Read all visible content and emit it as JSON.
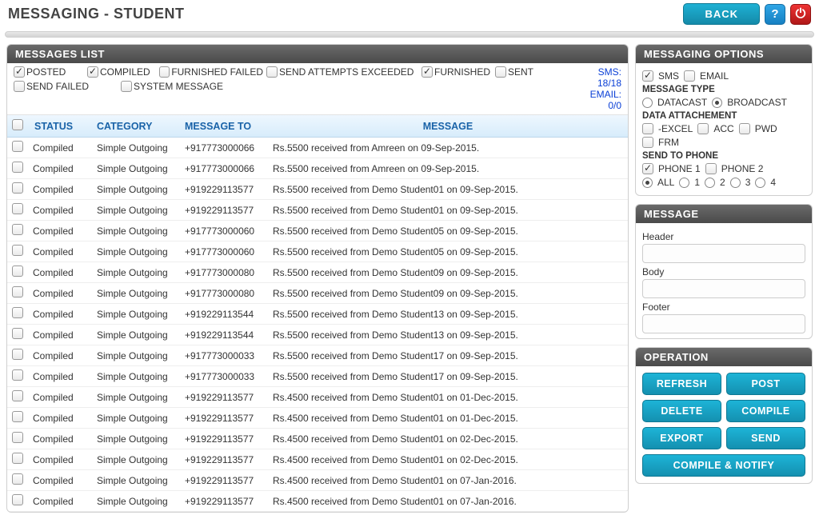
{
  "title": "MESSAGING - STUDENT",
  "back_label": "BACK",
  "counts": {
    "sms": "SMS: 18/18",
    "email": "EMAIL: 0/0"
  },
  "filters": [
    {
      "id": "posted",
      "label": "POSTED",
      "checked": true
    },
    {
      "id": "compiled",
      "label": "COMPILED",
      "checked": true
    },
    {
      "id": "ffailed",
      "label": "FURNISHED FAILED",
      "checked": false
    },
    {
      "id": "sae",
      "label": "SEND ATTEMPTS EXCEEDED",
      "checked": false
    },
    {
      "id": "furnished",
      "label": "FURNISHED",
      "checked": true
    },
    {
      "id": "sent",
      "label": "SENT",
      "checked": false
    },
    {
      "id": "sfailed",
      "label": "SEND FAILED",
      "checked": false
    },
    {
      "id": "sysmsg",
      "label": "SYSTEM MESSAGE",
      "checked": false
    }
  ],
  "columns": {
    "status": "STATUS",
    "category": "CATEGORY",
    "to": "MESSAGE TO",
    "msg": "MESSAGE"
  },
  "rows": [
    {
      "status": "Compiled",
      "category": "Simple Outgoing",
      "to": "+917773000066",
      "msg": "Rs.5500 received from Amreen on 09-Sep-2015."
    },
    {
      "status": "Compiled",
      "category": "Simple Outgoing",
      "to": "+917773000066",
      "msg": "Rs.5500 received from Amreen on 09-Sep-2015."
    },
    {
      "status": "Compiled",
      "category": "Simple Outgoing",
      "to": "+919229113577",
      "msg": "Rs.5500 received from Demo Student01 on 09-Sep-2015."
    },
    {
      "status": "Compiled",
      "category": "Simple Outgoing",
      "to": "+919229113577",
      "msg": "Rs.5500 received from Demo Student01 on 09-Sep-2015."
    },
    {
      "status": "Compiled",
      "category": "Simple Outgoing",
      "to": "+917773000060",
      "msg": "Rs.5500 received from Demo Student05 on 09-Sep-2015."
    },
    {
      "status": "Compiled",
      "category": "Simple Outgoing",
      "to": "+917773000060",
      "msg": "Rs.5500 received from Demo Student05 on 09-Sep-2015."
    },
    {
      "status": "Compiled",
      "category": "Simple Outgoing",
      "to": "+917773000080",
      "msg": "Rs.5500 received from Demo Student09 on 09-Sep-2015."
    },
    {
      "status": "Compiled",
      "category": "Simple Outgoing",
      "to": "+917773000080",
      "msg": "Rs.5500 received from Demo Student09 on 09-Sep-2015."
    },
    {
      "status": "Compiled",
      "category": "Simple Outgoing",
      "to": "+919229113544",
      "msg": "Rs.5500 received from Demo Student13 on 09-Sep-2015."
    },
    {
      "status": "Compiled",
      "category": "Simple Outgoing",
      "to": "+919229113544",
      "msg": "Rs.5500 received from Demo Student13 on 09-Sep-2015."
    },
    {
      "status": "Compiled",
      "category": "Simple Outgoing",
      "to": "+917773000033",
      "msg": "Rs.5500 received from Demo Student17 on 09-Sep-2015."
    },
    {
      "status": "Compiled",
      "category": "Simple Outgoing",
      "to": "+917773000033",
      "msg": "Rs.5500 received from Demo Student17 on 09-Sep-2015."
    },
    {
      "status": "Compiled",
      "category": "Simple Outgoing",
      "to": "+919229113577",
      "msg": "Rs.4500 received from Demo Student01 on 01-Dec-2015."
    },
    {
      "status": "Compiled",
      "category": "Simple Outgoing",
      "to": "+919229113577",
      "msg": "Rs.4500 received from Demo Student01 on 01-Dec-2015."
    },
    {
      "status": "Compiled",
      "category": "Simple Outgoing",
      "to": "+919229113577",
      "msg": "Rs.4500 received from Demo Student01 on 02-Dec-2015."
    },
    {
      "status": "Compiled",
      "category": "Simple Outgoing",
      "to": "+919229113577",
      "msg": "Rs.4500 received from Demo Student01 on 02-Dec-2015."
    },
    {
      "status": "Compiled",
      "category": "Simple Outgoing",
      "to": "+919229113577",
      "msg": "Rs.4500 received from Demo Student01 on 07-Jan-2016."
    },
    {
      "status": "Compiled",
      "category": "Simple Outgoing",
      "to": "+919229113577",
      "msg": "Rs.4500 received from Demo Student01 on 07-Jan-2016."
    }
  ],
  "panels": {
    "list": "MESSAGES LIST",
    "options": "MESSAGING OPTIONS",
    "message": "MESSAGE",
    "operation": "OPERATION"
  },
  "options": {
    "sms": {
      "label": "SMS",
      "checked": true
    },
    "email": {
      "label": "EMAIL",
      "checked": false
    },
    "msgtype_label": "MESSAGE TYPE",
    "msgtype": {
      "datacast": "DATACAST",
      "broadcast": "BROADCAST",
      "selected": "broadcast"
    },
    "attach_label": "DATA ATTACHEMENT",
    "attach": {
      "excel": {
        "label": "-EXCEL",
        "checked": false
      },
      "acc": {
        "label": "ACC",
        "checked": false
      },
      "pwd": {
        "label": "PWD",
        "checked": false
      },
      "frm": {
        "label": "FRM",
        "checked": false
      }
    },
    "sendto_label": "SEND TO PHONE",
    "phone1": {
      "label": "PHONE 1",
      "checked": true
    },
    "phone2": {
      "label": "PHONE 2",
      "checked": false
    },
    "scope": {
      "all": "ALL",
      "one": "1",
      "two": "2",
      "three": "3",
      "four": "4",
      "selected": "all"
    }
  },
  "message_fields": {
    "header": "Header",
    "body": "Body",
    "footer": "Footer"
  },
  "ops": {
    "refresh": "REFRESH",
    "post": "POST",
    "delete": "DELETE",
    "compile": "COMPILE",
    "export": "EXPORT",
    "send": "SEND",
    "compile_notify": "COMPILE & NOTIFY"
  }
}
